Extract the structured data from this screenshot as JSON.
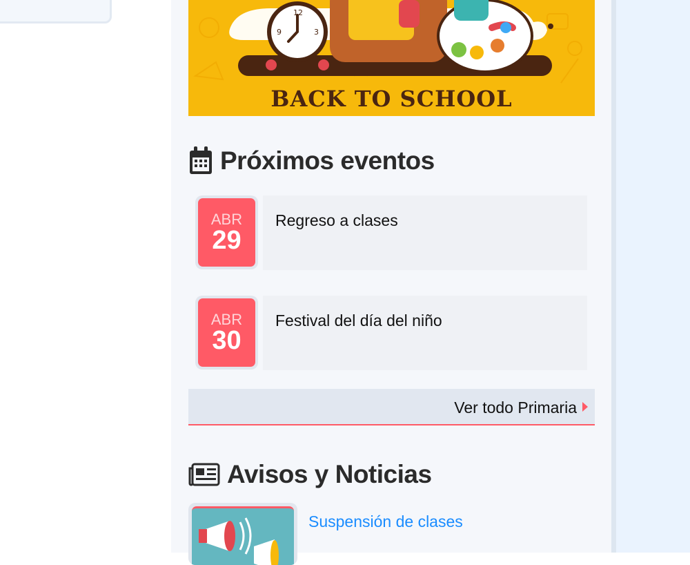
{
  "banner": {
    "text": "BACK TO SCHOOL"
  },
  "events": {
    "title": "Próximos eventos",
    "items": [
      {
        "month": "ABR",
        "day": "29",
        "title": "Regreso a clases"
      },
      {
        "month": "ABR",
        "day": "30",
        "title": "Festival del día del niño"
      }
    ],
    "see_all": "Ver todo Primaria"
  },
  "news": {
    "title": "Avisos y Noticias",
    "items": [
      {
        "title": "Suspensión de clases"
      }
    ]
  },
  "colors": {
    "accent": "#ff5a66",
    "banner": "#f7b90b",
    "link": "#1a8cff"
  }
}
